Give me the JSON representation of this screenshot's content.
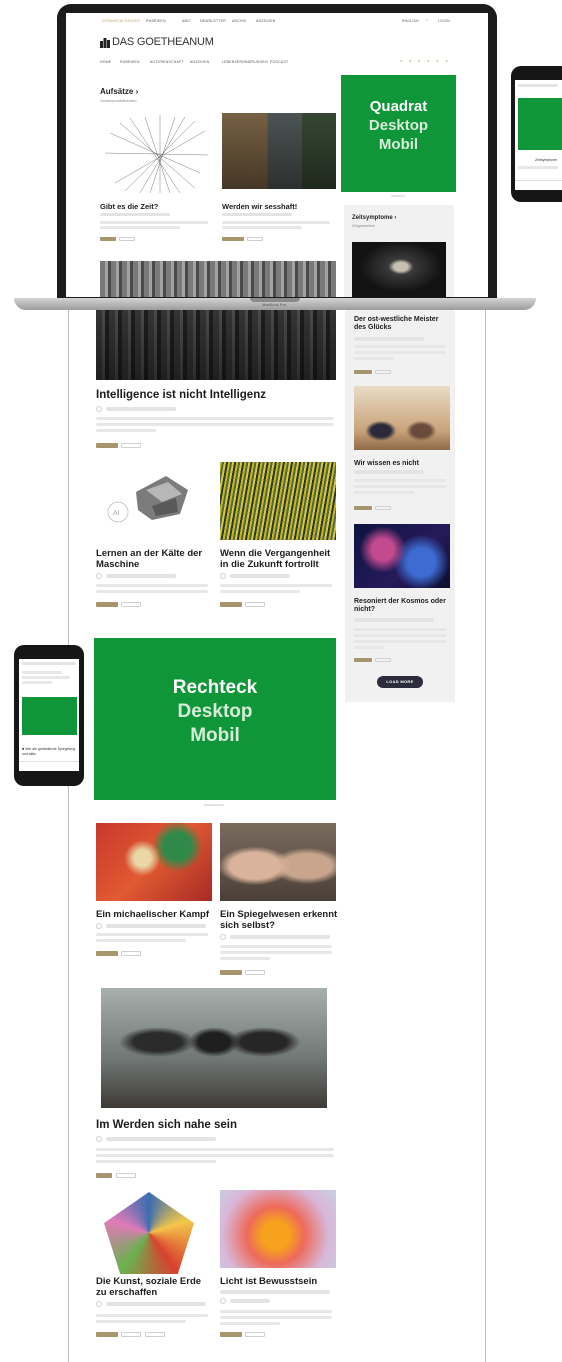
{
  "laptop": {
    "brand_label": "MacBook Pro",
    "topnav": [
      "VERANSTALTUNGEN",
      "RUBRIKEN",
      "ABO",
      "NEWSLETTER",
      "ARCHIV",
      "ANZEIGEN"
    ],
    "topnav_right": [
      "ENGLISH",
      "LOGIN"
    ],
    "logo": "DAS GOETHEANUM",
    "mainnav": [
      "HOME",
      "RUBRIKEN",
      "AUTORENSCHAFT",
      "ANZEIGEN",
      "LEBENSERINNERUNGEN",
      "PODCAST"
    ],
    "section_title": "Aufsätze ›",
    "section_sub": "Schwerpunktthemen",
    "articles": [
      {
        "title": "Gibt es die Zeit?"
      },
      {
        "title": "Werden wir sesshaft!"
      }
    ],
    "sidebar_title": "Zeitsymptome ›",
    "sidebar_sub": "Zeitgeschehen",
    "ad_quadrat": {
      "line1": "Quadrat",
      "line2": "Desktop",
      "line3": "Mobil"
    }
  },
  "page": {
    "articles": [
      {
        "title": "Intelligence ist nicht Intelligenz"
      },
      {
        "title": "Lernen an der Kälte der Maschine"
      },
      {
        "title": "Wenn die Vergangenheit in die Zukunft fortrollt"
      },
      {
        "title": "Ein michaelischer Kampf"
      },
      {
        "title": "Ein Spiegelwesen erkennt sich selbst?"
      },
      {
        "title": "Im Werden sich nahe sein"
      },
      {
        "title": "Die Kunst, soziale Erde zu erschaffen"
      },
      {
        "title": "Licht ist Bewusstsein"
      }
    ],
    "sidebar": [
      {
        "title": "Der ost-westliche Meister des Glücks"
      },
      {
        "title": "Wir wissen es nicht"
      },
      {
        "title": "Resoniert der Kosmos oder nicht?"
      }
    ],
    "load_more": "LOAD MORE",
    "ad_rechteck": {
      "line1": "Rechteck",
      "line2": "Desktop",
      "line3": "Mobil"
    }
  },
  "phone_left": {
    "caption": "■ Wer die gedankliche Spiegelung und aktiv"
  },
  "phone_right": {
    "caption": "Zeitsymptome"
  },
  "colors": {
    "ad_green": "#0e9638",
    "tag_gold": "#a8956d",
    "sidebar_bg": "#f1f1f1",
    "button_dark": "#2c2c3a"
  }
}
